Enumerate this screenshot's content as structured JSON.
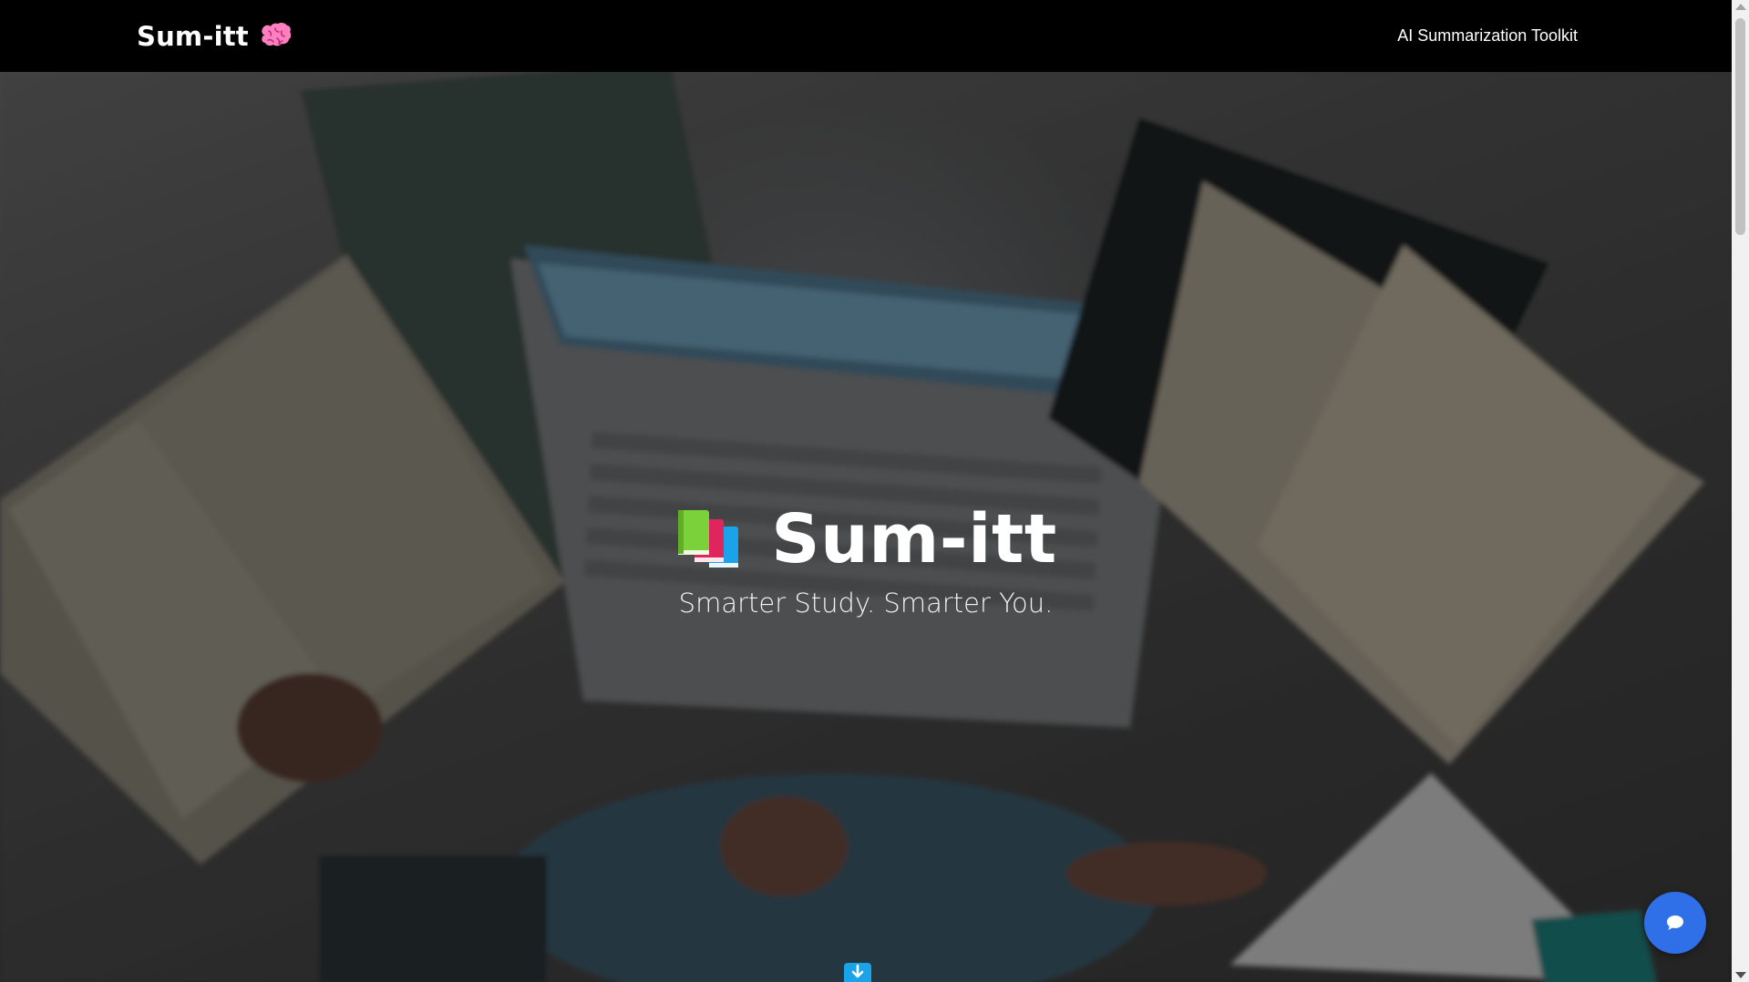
{
  "navbar": {
    "brand_name": "Sum-itt",
    "brand_icon": "brain-icon",
    "link_label": "AI Summarization Toolkit"
  },
  "hero": {
    "icon": "books-icon",
    "title": "Sum-itt",
    "subtitle": "Smarter Study. Smarter You.",
    "background": "blurred photo of a person studying with laptop and open books"
  },
  "scroll_button": {
    "icon": "arrow-down-icon",
    "color": "#1aa3e8"
  },
  "chat_button": {
    "icon": "chat-bubble-icon",
    "color": "#2f6fe8"
  },
  "colors": {
    "brand_pink": "#ff6fb5",
    "book_green": "#7bd13a",
    "book_red": "#e0245e",
    "book_blue": "#1aa3e8"
  }
}
